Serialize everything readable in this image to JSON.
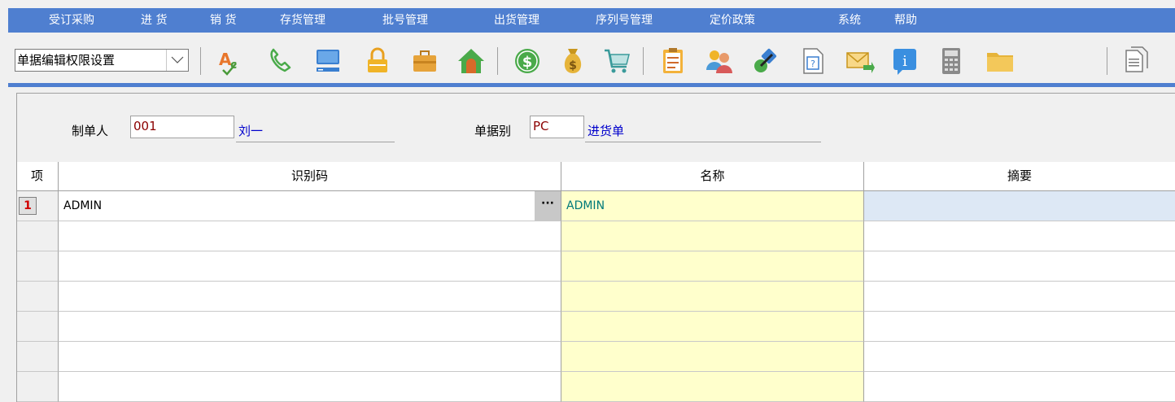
{
  "menu": {
    "items": [
      {
        "label": "受订采购"
      },
      {
        "label": "进 货"
      },
      {
        "label": "销 货"
      },
      {
        "label": "存货管理"
      },
      {
        "label": "批号管理"
      },
      {
        "label": "出货管理"
      },
      {
        "label": "序列号管理"
      },
      {
        "label": "定价政策"
      },
      {
        "label": "系统"
      },
      {
        "label": "帮助"
      }
    ]
  },
  "toolbar": {
    "combo_value": "单据编辑权限设置",
    "icons": [
      "spellcheck-icon",
      "phone-icon",
      "computer-icon",
      "lock-icon",
      "briefcase-icon",
      "home-icon",
      "dollar-icon",
      "money-bag-icon",
      "cart-icon",
      "clipboard-icon",
      "users-icon",
      "link-icon",
      "help-document-icon",
      "mail-icon",
      "info-icon",
      "calculator-icon",
      "folder-icon",
      "copy-document-icon"
    ]
  },
  "header": {
    "maker_label": "制单人",
    "maker_code": "001",
    "maker_name": "刘一",
    "doc_type_label": "单据别",
    "doc_type_code": "PC",
    "doc_type_name": "进货单"
  },
  "grid": {
    "columns": [
      "项",
      "识别码",
      "名称",
      "摘要"
    ],
    "rows": [
      {
        "index": "1",
        "code": "ADMIN",
        "name": "ADMIN",
        "summary": ""
      },
      {
        "index": "",
        "code": "",
        "name": "",
        "summary": ""
      },
      {
        "index": "",
        "code": "",
        "name": "",
        "summary": ""
      },
      {
        "index": "",
        "code": "",
        "name": "",
        "summary": ""
      },
      {
        "index": "",
        "code": "",
        "name": "",
        "summary": ""
      },
      {
        "index": "",
        "code": "",
        "name": "",
        "summary": ""
      },
      {
        "index": "",
        "code": "",
        "name": "",
        "summary": ""
      }
    ],
    "ellipsis": "···"
  },
  "colors": {
    "menu_bg": "#4f7fd0",
    "name_column_bg": "#ffffcc",
    "summary_selected_bg": "#dde8f5",
    "index_number_color": "#d00000"
  }
}
